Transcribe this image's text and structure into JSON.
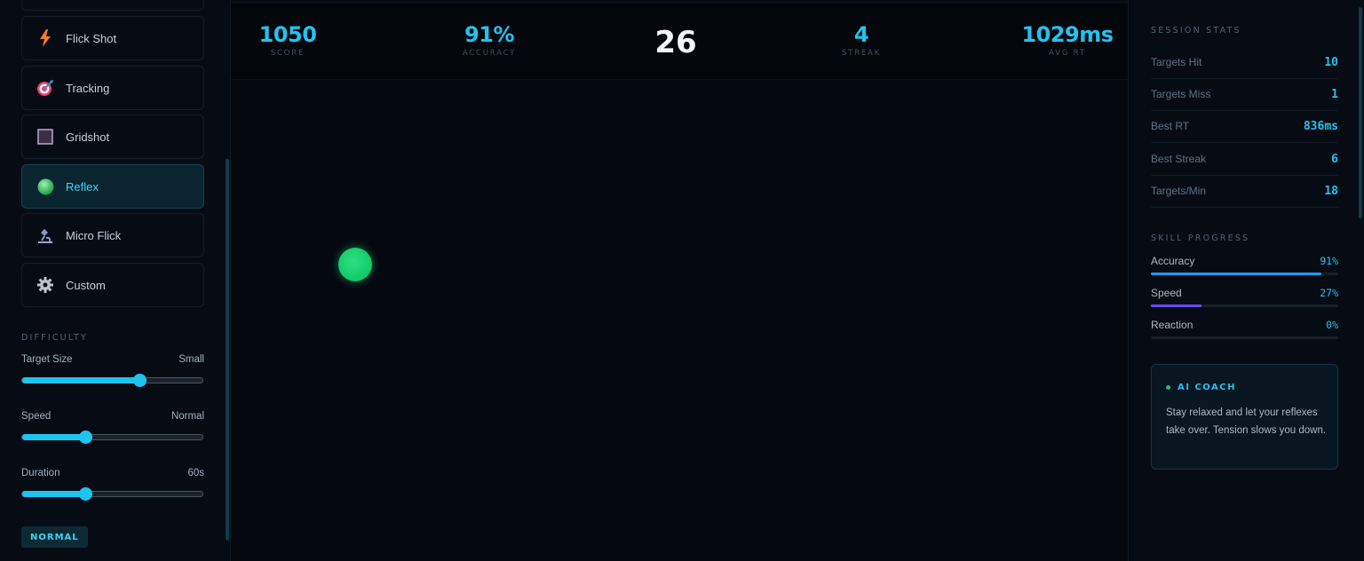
{
  "sidebar": {
    "modes": [
      {
        "label": "Flick Shot",
        "icon": "lightning-icon"
      },
      {
        "label": "Tracking",
        "icon": "target-dart-icon"
      },
      {
        "label": "Gridshot",
        "icon": "grid-square-icon"
      },
      {
        "label": "Reflex",
        "icon": "green-orb-icon",
        "active": true
      },
      {
        "label": "Micro Flick",
        "icon": "microscope-icon"
      },
      {
        "label": "Custom",
        "icon": "gear-icon"
      }
    ],
    "difficulty_label": "DIFFICULTY",
    "sliders": [
      {
        "label": "Target Size",
        "value_text": "Small",
        "level": 0.65
      },
      {
        "label": "Speed",
        "value_text": "Normal",
        "level": 0.35
      },
      {
        "label": "Duration",
        "value_text": "60s",
        "level": 0.35
      }
    ],
    "badge": "NORMAL"
  },
  "stats": [
    {
      "value": "1050",
      "label": "SCORE"
    },
    {
      "value": "91%",
      "label": "ACCURACY"
    },
    {
      "value": "4",
      "label": "STREAK"
    },
    {
      "value": "1029ms",
      "label": "AVG RT"
    }
  ],
  "timer": "26",
  "session": {
    "title": "SESSION STATS",
    "rows": [
      {
        "k": "Targets Hit",
        "v": "10"
      },
      {
        "k": "Targets Miss",
        "v": "1"
      },
      {
        "k": "Best RT",
        "v": "836ms"
      },
      {
        "k": "Best Streak",
        "v": "6"
      },
      {
        "k": "Targets/Min",
        "v": "18"
      }
    ]
  },
  "skills": {
    "title": "SKILL PROGRESS",
    "items": [
      {
        "label": "Accuracy",
        "pct": "91%",
        "level": 0.91,
        "color": "#1e9af0"
      },
      {
        "label": "Speed",
        "pct": "27%",
        "level": 0.27,
        "color": "#6a4cf0"
      },
      {
        "label": "Reaction",
        "pct": "0%",
        "level": 0.0,
        "color": "#22c3ee"
      }
    ]
  },
  "coach": {
    "title": "AI COACH",
    "message": "Stay relaxed and let your reflexes take over. Tension slows you down."
  },
  "colors": {
    "accent": "#22c3ee",
    "target": "#10c96a",
    "background": "#05090f"
  }
}
